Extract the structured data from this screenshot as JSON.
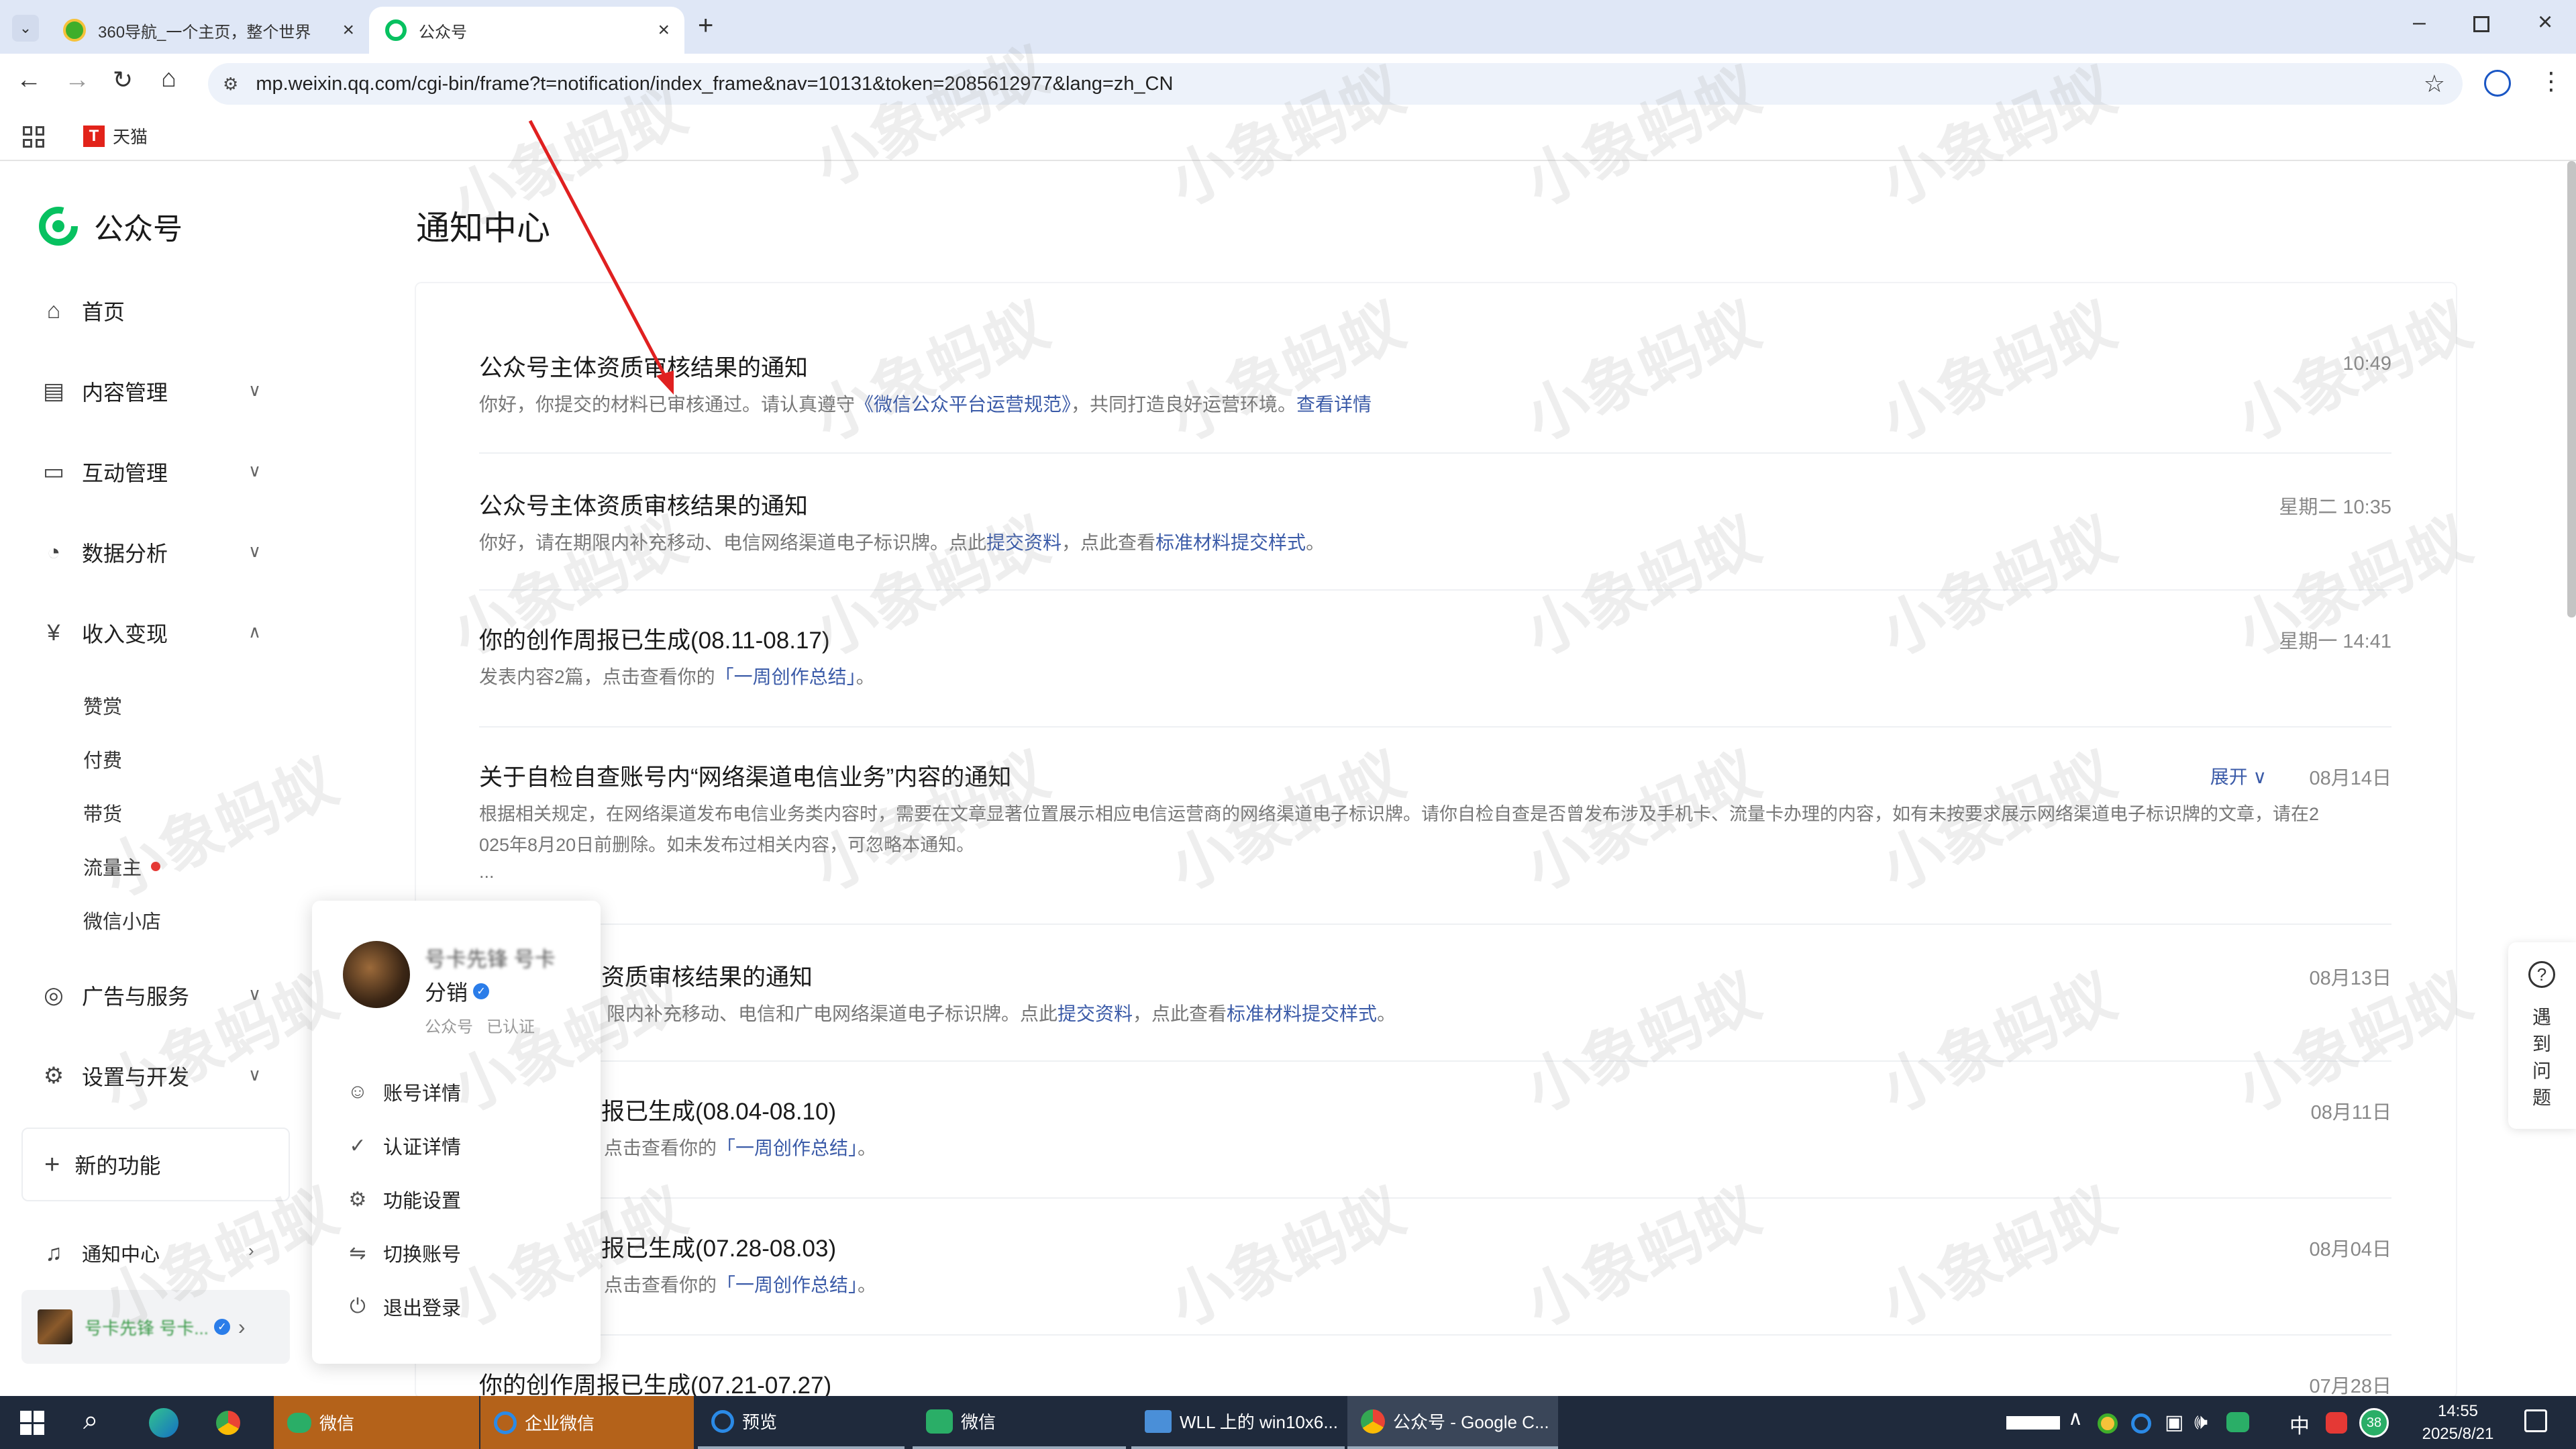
{
  "browser": {
    "tabs": [
      {
        "title": "360导航_一个主页，整个世界"
      },
      {
        "title": "公众号"
      }
    ],
    "url": "mp.weixin.qq.com/cgi-bin/frame?t=notification/index_frame&nav=10131&token=2085612977&lang=zh_CN",
    "bookmarks": [
      {
        "label": "天猫"
      }
    ]
  },
  "brand": {
    "name": "公众号"
  },
  "sidebar": {
    "items": [
      {
        "label": "首页",
        "icon": "home-icon"
      },
      {
        "label": "内容管理",
        "icon": "document-icon"
      },
      {
        "label": "互动管理",
        "icon": "chat-icon"
      },
      {
        "label": "数据分析",
        "icon": "chart-icon"
      },
      {
        "label": "收入变现",
        "icon": "yen-icon"
      }
    ],
    "sub_items": [
      {
        "label": "赞赏"
      },
      {
        "label": "付费"
      },
      {
        "label": "带货"
      },
      {
        "label": "流量主"
      },
      {
        "label": "微信小店"
      }
    ],
    "items2": [
      {
        "label": "广告与服务",
        "icon": "compass-icon"
      },
      {
        "label": "设置与开发",
        "icon": "gear-icon"
      }
    ],
    "new_feature": "新的功能",
    "notification_center": "通知中心",
    "account_name": "号卡先锋 号卡..."
  },
  "main": {
    "title": "通知中心",
    "notices": [
      {
        "title": "公众号主体资质审核结果的通知",
        "time": "10:49",
        "desc_before": "你好，你提交的材料已审核通过。请认真遵守",
        "link1": "《微信公众平台运营规范》",
        "desc_mid": "，共同打造良好运营环境。",
        "link2": "查看详情",
        "desc_after": ""
      },
      {
        "title": "公众号主体资质审核结果的通知",
        "time": "星期二 10:35",
        "desc_before": "你好，请在期限内补充移动、电信网络渠道电子标识牌。点此",
        "link1": "提交资料",
        "desc_mid": "，点此查看",
        "link2": "标准材料提交样式",
        "desc_after": "。"
      },
      {
        "title": "你的创作周报已生成(08.11-08.17)",
        "time": "星期一 14:41",
        "desc_before": "发表内容2篇，点击查看你的",
        "link1": "「一周创作总结」",
        "desc_mid": "。",
        "link2": "",
        "desc_after": ""
      },
      {
        "title": "关于自检自查账号内“网络渠道电信业务”内容的通知",
        "time": "08月14日",
        "expand": "展开",
        "desc_line1": "根据相关规定，在网络渠道发布电信业务类内容时，需要在文章显著位置展示相应电信运营商的网络渠道电子标识牌。请你自检自查是否曾发布涉及手机卡、流量卡办理的内容，如有未按要求展示网络渠道电子标识牌的文章，请在2",
        "desc_line2": "025年8月20日前删除。如未发布过相关内容，可忽略本通知。",
        "ellipsis": "..."
      },
      {
        "title": "资质审核结果的通知",
        "time": "08月13日",
        "desc_before": "限内补充移动、电信和广电网络渠道电子标识牌。点此",
        "link1": "提交资料",
        "desc_mid": "，点此查看",
        "link2": "标准材料提交样式",
        "desc_after": "。"
      },
      {
        "title": "报已生成(08.04-08.10)",
        "time": "08月11日",
        "desc_before": "点击查看你的",
        "link1": "「一周创作总结」",
        "desc_mid": "。",
        "link2": "",
        "desc_after": ""
      },
      {
        "title": "报已生成(07.28-08.03)",
        "time": "08月04日",
        "desc_before": "点击查看你的",
        "link1": "「一周创作总结」",
        "desc_mid": "。",
        "link2": "",
        "desc_after": ""
      },
      {
        "title": "你的创作周报已生成(07.21-07.27)",
        "time": "07月28日"
      }
    ]
  },
  "popover": {
    "account_name_line1": "号卡先锋 号卡",
    "account_name_line2": "分销",
    "type": "公众号",
    "status": "已认证",
    "items": [
      {
        "label": "账号详情",
        "icon": "user-icon"
      },
      {
        "label": "认证详情",
        "icon": "check-circle-icon"
      },
      {
        "label": "功能设置",
        "icon": "gear-icon"
      },
      {
        "label": "切换账号",
        "icon": "switch-icon"
      },
      {
        "label": "退出登录",
        "icon": "power-icon"
      }
    ]
  },
  "help": {
    "label_chars": [
      "遇",
      "到",
      "问",
      "题"
    ]
  },
  "watermark": "小象蚂蚁",
  "taskbar": {
    "apps": [
      {
        "label": "微信"
      },
      {
        "label": "企业微信"
      },
      {
        "label": "预览"
      },
      {
        "label": "微信"
      },
      {
        "label": "WLL 上的 win10x6..."
      },
      {
        "label": "公众号 - Google C..."
      }
    ],
    "ime": "中",
    "badge": "38",
    "time": "14:55",
    "date": "2025/8/21"
  },
  "colors": {
    "link": "#3b5ba8",
    "brand_green": "#07c160",
    "red_dot": "#e53935",
    "annotation_arrow": "#e02020"
  }
}
